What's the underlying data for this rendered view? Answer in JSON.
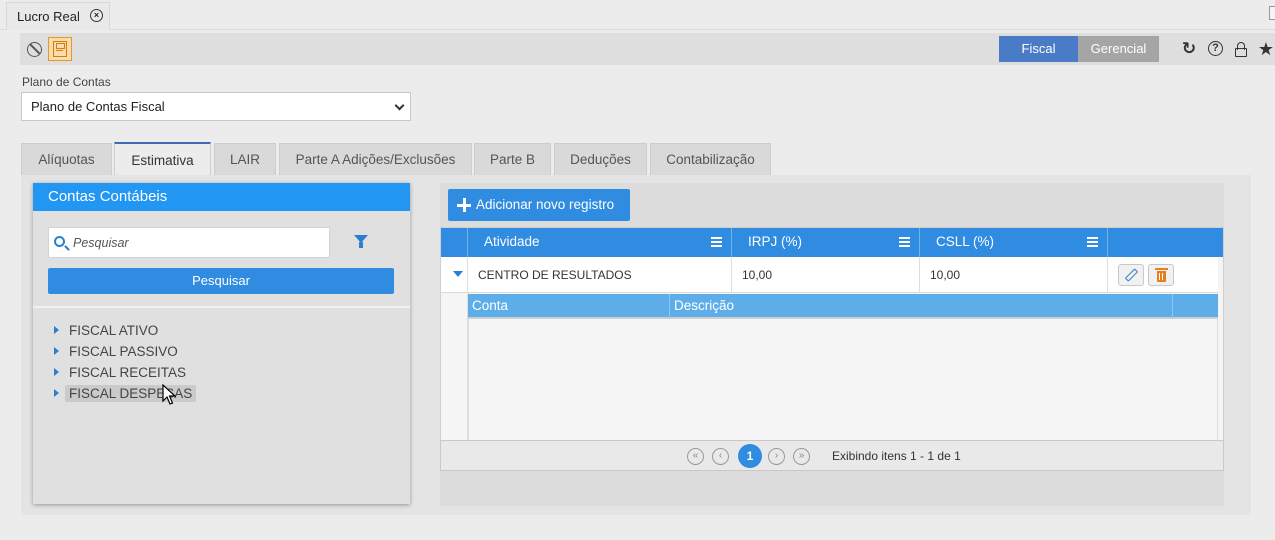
{
  "window": {
    "tab_title": "Lucro Real"
  },
  "toolbar": {
    "segments": [
      "Fiscal",
      "Gerencial"
    ],
    "active_segment": "Fiscal",
    "icons": [
      "cancel-icon",
      "save-icon",
      "refresh-icon",
      "help-icon",
      "lock-icon",
      "star-icon"
    ],
    "help_glyph": "?"
  },
  "plano": {
    "label": "Plano de Contas",
    "selected": "Plano de Contas Fiscal"
  },
  "tabs": [
    "Alíquotas",
    "Estimativa",
    "LAIR",
    "Parte A Adições/Exclusões",
    "Parte B",
    "Deduções",
    "Contabilização"
  ],
  "active_tab": "Estimativa",
  "contas": {
    "title": "Contas Contábeis",
    "search_placeholder": "Pesquisar",
    "search_button": "Pesquisar",
    "tree": [
      "FISCAL ATIVO",
      "FISCAL PASSIVO",
      "FISCAL RECEITAS",
      "FISCAL DESPESAS"
    ]
  },
  "grid": {
    "add_button": "Adicionar novo registro",
    "columns": [
      "Atividade",
      "IRPJ (%)",
      "CSLL (%)"
    ],
    "rows": [
      {
        "atividade": "CENTRO DE RESULTADOS",
        "irpj": "10,00",
        "csll": "10,00"
      }
    ],
    "sub_columns": [
      "Conta",
      "Descrição"
    ],
    "pager": {
      "current_page": "1",
      "info": "Exibindo itens 1 - 1 de 1"
    }
  },
  "colors": {
    "accent": "#2f8ce0",
    "fiscal_button": "#4a7bc7",
    "gerencial_button": "#a5a5a5",
    "delete": "#e67e22"
  }
}
